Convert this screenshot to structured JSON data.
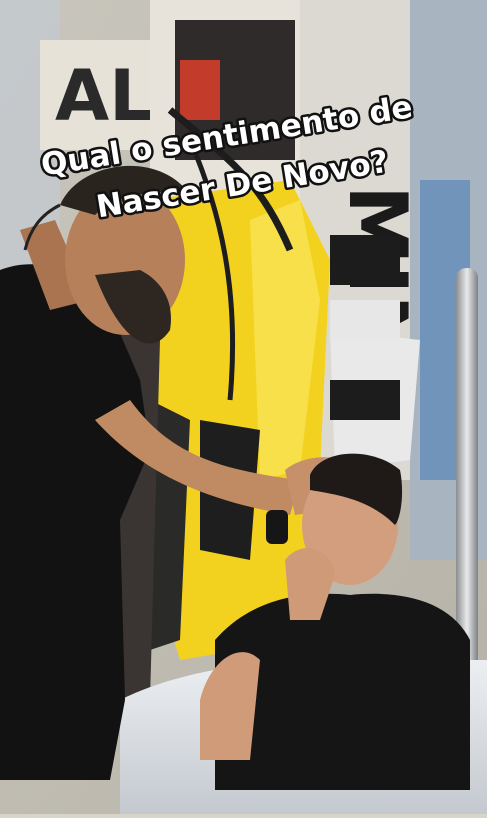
{
  "video": {
    "caption": {
      "line1": "Qual o sentimento de",
      "line2": "Nascer De Novo?"
    }
  }
}
